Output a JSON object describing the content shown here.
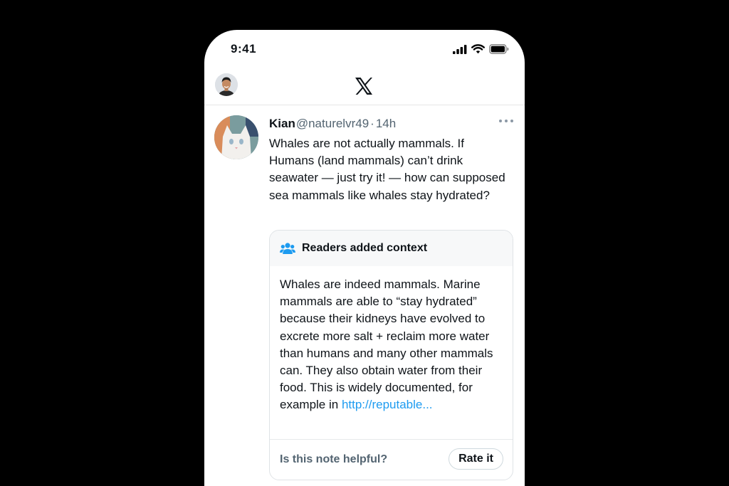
{
  "status_bar": {
    "time": "9:41"
  },
  "header": {
    "logo": "x-logo-icon"
  },
  "tweet": {
    "author_name": "Kian",
    "author_handle": "@naturelvr49",
    "separator": "·",
    "time": "14h",
    "text": "Whales are not actually mammals. If Humans (land mammals) can’t drink seawater — just try it! — how can supposed sea mammals like whales stay hydrated?"
  },
  "community_note": {
    "title": "Readers added context",
    "icon": "people-group-icon",
    "body": "Whales are indeed mammals. Marine mammals are able to “stay hydrated” because their kidneys have evolved to excrete more salt + reclaim more water than humans and many other mammals can. They also obtain water from their food. This is widely documented, for example in ",
    "link_text": "http://reputable...",
    "question": "Is this note helpful?",
    "rate_label": "Rate it"
  },
  "colors": {
    "accent": "#1d9bf0",
    "secondary_text": "#536471",
    "background": "#000000"
  }
}
